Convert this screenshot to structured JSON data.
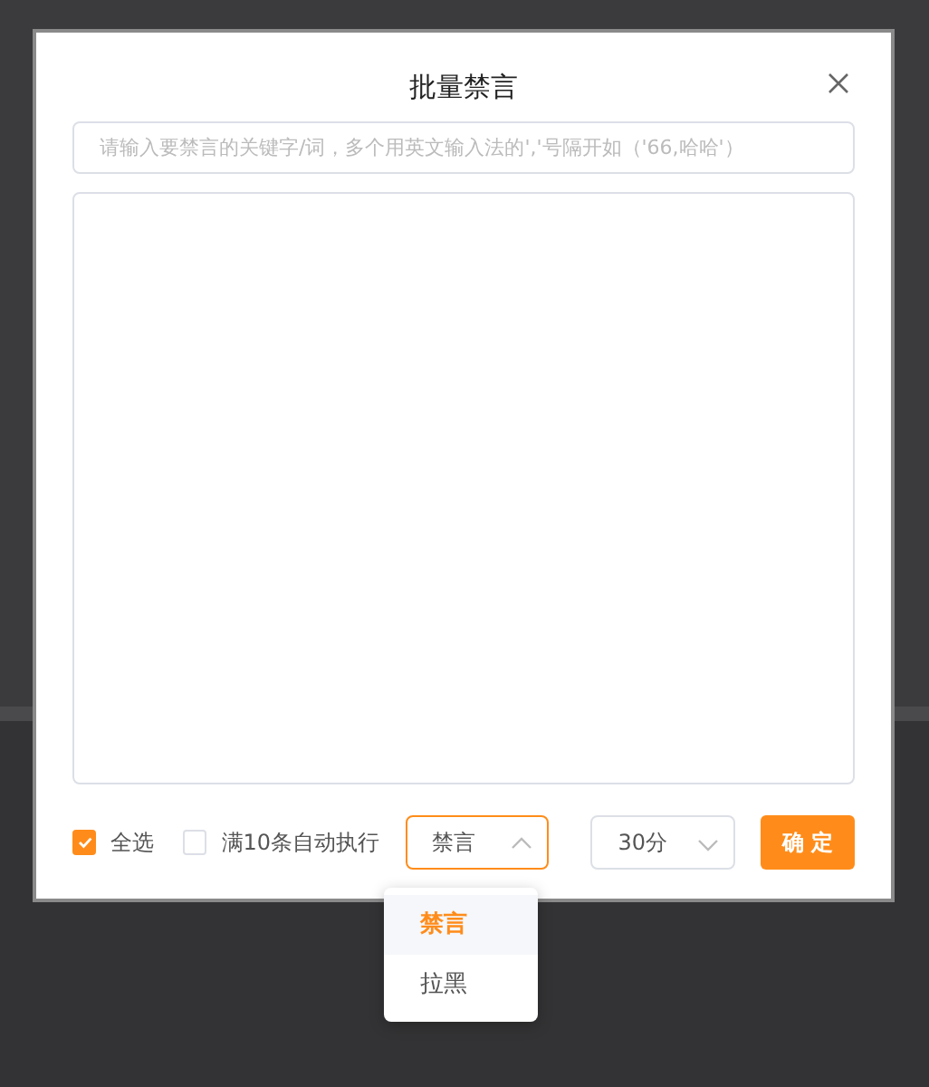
{
  "dialog": {
    "title": "批量禁言"
  },
  "keyword_field": {
    "placeholder": "请输入要禁言的关键字/词，多个用英文输入法的','号隔开如（'66,哈哈'）"
  },
  "select_all": {
    "label": "全选",
    "checked": true
  },
  "auto_execute": {
    "label": "满10条自动执行",
    "checked": false
  },
  "action_select": {
    "value": "禁言",
    "expanded": true,
    "options": [
      {
        "label": "禁言",
        "selected": true
      },
      {
        "label": "拉黑",
        "selected": false
      }
    ]
  },
  "duration_select": {
    "value": "30分",
    "expanded": false
  },
  "confirm_button": "确 定"
}
